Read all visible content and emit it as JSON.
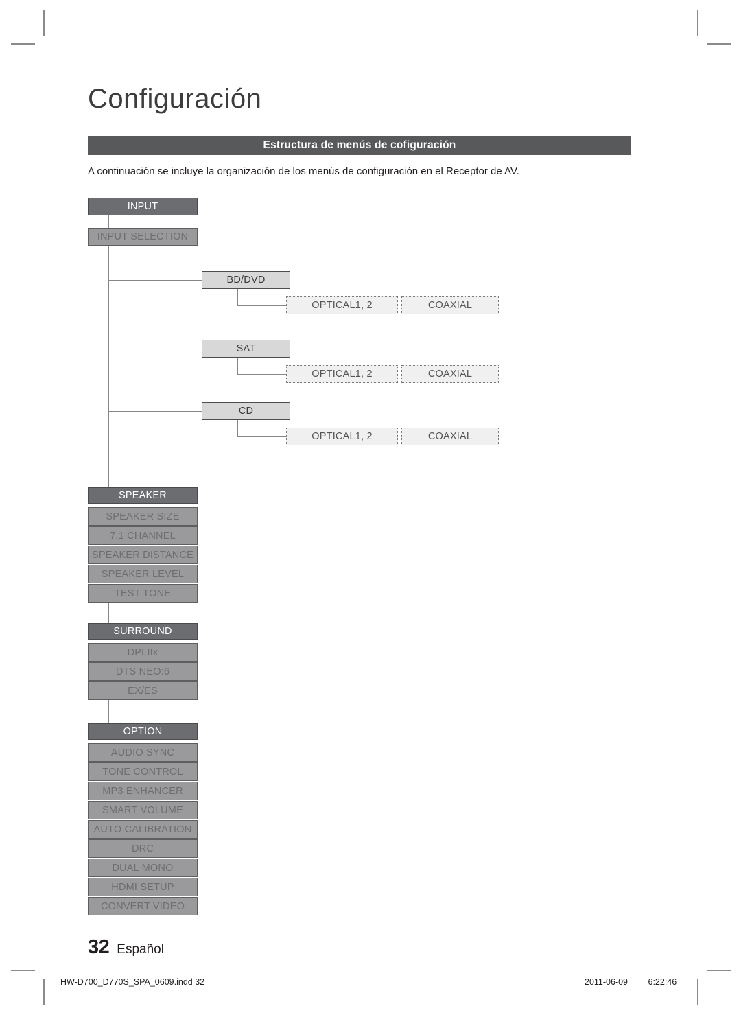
{
  "page": {
    "title": "Configuración",
    "section_bar": "Estructura de menús de cofiguración",
    "intro": "A continuación se incluye la organización de los menús de configuración en el Receptor de AV.",
    "number": "32",
    "language": "Español"
  },
  "footer": {
    "file": "HW-D700_D770S_SPA_0609.indd   32",
    "date": "2011-06-09",
    "time": "6:22:46"
  },
  "colors": {
    "header_node": "#6b6d70",
    "item_node": "#9a9a9d",
    "sub_node": "#d8d8d8",
    "leaf_node": "#f0f0f0",
    "section_bar": "#58595b",
    "line": "#87878a"
  },
  "diagram": {
    "groups": [
      {
        "id": "input",
        "header": "INPUT",
        "items": [
          "INPUT SELECTION"
        ],
        "sources": [
          {
            "label": "BD/DVD",
            "terminals": [
              "OPTICAL1, 2",
              "COAXIAL"
            ]
          },
          {
            "label": "SAT",
            "terminals": [
              "OPTICAL1, 2",
              "COAXIAL"
            ]
          },
          {
            "label": "CD",
            "terminals": [
              "OPTICAL1, 2",
              "COAXIAL"
            ]
          }
        ]
      },
      {
        "id": "speaker",
        "header": "SPEAKER",
        "items": [
          "SPEAKER SIZE",
          "7.1 CHANNEL",
          "SPEAKER DISTANCE",
          "SPEAKER LEVEL",
          "TEST TONE"
        ]
      },
      {
        "id": "surround",
        "header": "SURROUND",
        "items": [
          "DPLIIx",
          "DTS NEO:6",
          "EX/ES"
        ]
      },
      {
        "id": "option",
        "header": "OPTION",
        "items": [
          "AUDIO SYNC",
          "TONE CONTROL",
          "MP3 ENHANCER",
          "SMART VOLUME",
          "AUTO CALIBRATION",
          "DRC",
          "DUAL MONO",
          "HDMI SETUP",
          "CONVERT VIDEO"
        ]
      }
    ]
  }
}
